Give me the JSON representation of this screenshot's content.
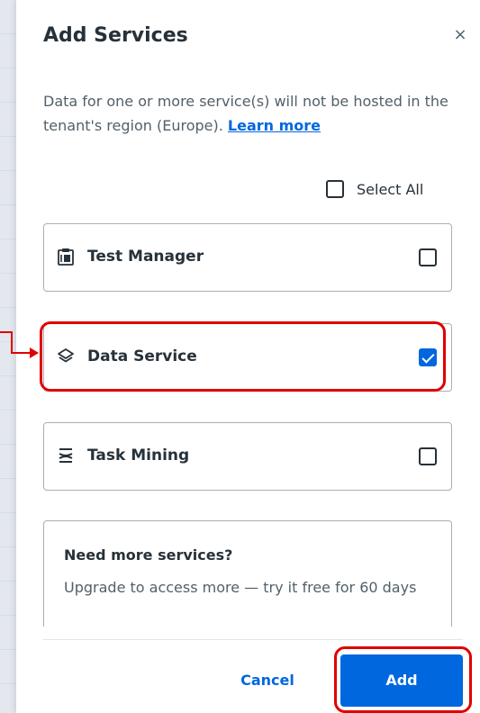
{
  "dialog": {
    "title": "Add Services",
    "close_glyph": "×",
    "notice_text": "Data for one or more service(s) will not be hosted in the tenant's region (Europe). ",
    "learn_more": "Learn more"
  },
  "select_all": {
    "label": "Select All",
    "checked": false
  },
  "services": [
    {
      "name": "Test Manager",
      "icon": "test-manager-icon",
      "checked": false
    },
    {
      "name": "Data Service",
      "icon": "layers-icon",
      "checked": true
    },
    {
      "name": "Task Mining",
      "icon": "task-mining-icon",
      "checked": false
    }
  ],
  "upsell": {
    "title": "Need more services?",
    "text": "Upgrade to access more — try it free for 60 days"
  },
  "footer": {
    "cancel_label": "Cancel",
    "add_label": "Add"
  },
  "colors": {
    "primary": "#0067df",
    "annotation": "#e00000",
    "border": "#a4b1b8"
  }
}
